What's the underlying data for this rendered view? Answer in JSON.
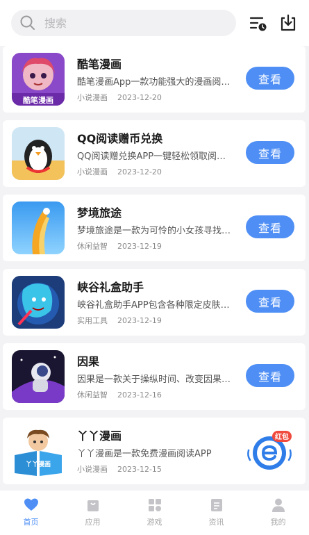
{
  "search": {
    "placeholder": "搜索"
  },
  "header": {
    "filter_icon": "sort-clock-icon",
    "download_icon": "download-icon"
  },
  "apps": [
    {
      "title": "酷笔漫画",
      "desc": "酷笔漫画App一款功能强大的漫画阅读工具",
      "category": "小说漫画",
      "date": "2023-12-20",
      "button": "查看",
      "icon": "anime-girl-thumbnail",
      "thumb_text": "酷笔漫画"
    },
    {
      "title": "QQ阅读赠币兑换",
      "desc": "QQ阅读赠兑换APP一键轻松领取阅读赠币",
      "category": "小说漫画",
      "date": "2023-12-20",
      "button": "查看",
      "icon": "penguin-thumbnail"
    },
    {
      "title": "梦境旅途",
      "desc": "梦境旅途是一款为可怜的小女孩寻找出路的游戏",
      "category": "休闲益智",
      "date": "2023-12-19",
      "button": "查看",
      "icon": "ramp-thumbnail"
    },
    {
      "title": "峡谷礼盒助手",
      "desc": "峡谷礼盒助手APP包含各种限定皮肤礼盒",
      "category": "实用工具",
      "date": "2023-12-19",
      "button": "查看",
      "icon": "hero-thumbnail"
    },
    {
      "title": "因果",
      "desc": "因果是一款关于操纵时间、改变因果的游戏",
      "category": "休闲益智",
      "date": "2023-12-16",
      "button": "查看",
      "icon": "astronaut-thumbnail"
    },
    {
      "title": "丫丫漫画",
      "desc": "丫丫漫画是一款免费漫画阅读APP",
      "category": "小说漫画",
      "date": "2023-12-15",
      "button": "查看",
      "icon": "girl-book-thumbnail",
      "thumb_text": "丫丫漫画"
    }
  ],
  "float_badge": {
    "label": "红包",
    "icon": "red-packet-e-icon"
  },
  "nav": [
    {
      "label": "首页",
      "icon": "heart-home-icon",
      "active": true
    },
    {
      "label": "应用",
      "icon": "app-bag-icon"
    },
    {
      "label": "游戏",
      "icon": "grid-icon"
    },
    {
      "label": "资讯",
      "icon": "news-icon"
    },
    {
      "label": "我的",
      "icon": "user-icon"
    }
  ],
  "colors": {
    "accent": "#4f8ff5",
    "badge_red": "#f04a3e",
    "background": "#f3f3f5"
  }
}
